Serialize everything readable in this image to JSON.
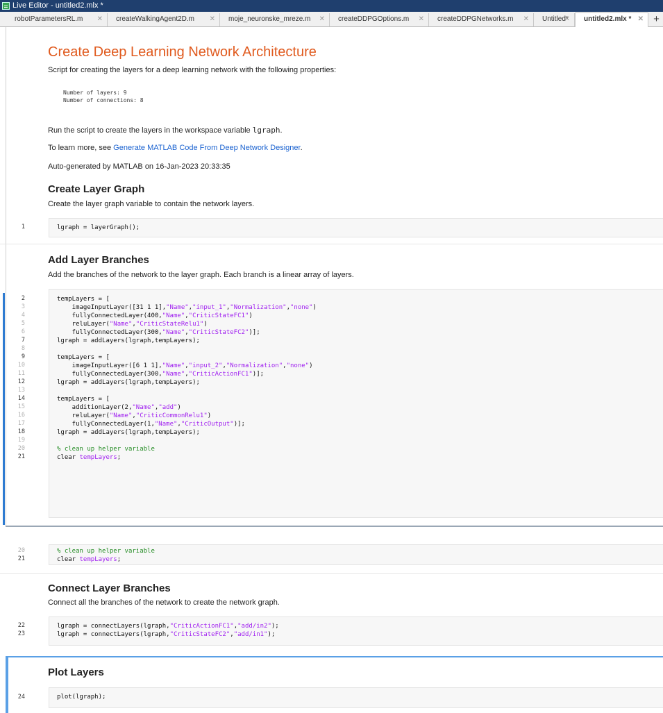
{
  "window": {
    "title": "Live Editor - untitled2.mlx *"
  },
  "tabs": [
    {
      "label": "robotParametersRL.m",
      "close": "✕"
    },
    {
      "label": "createWalkingAgent2D.m",
      "close": "✕"
    },
    {
      "label": "moje_neuronske_mreze.m",
      "close": "✕"
    },
    {
      "label": "createDDPGOptions.m",
      "close": "✕"
    },
    {
      "label": "createDDPGNetworks.m",
      "close": "✕"
    },
    {
      "label": "Untitled*",
      "close": "✕"
    },
    {
      "label": "untitled2.mlx *",
      "close": "✕"
    }
  ],
  "new_tab_label": "+",
  "doc": {
    "title": "Create Deep Learning Network Architecture",
    "intro": "Script for creating the layers for a deep learning network with the following properties:",
    "prop1": "Number of layers: 9",
    "prop2": "Number of connections: 8",
    "run_text_a": "Run the script to create the layers in the workspace variable ",
    "run_text_var": "lgraph",
    "run_text_b": ".",
    "learn_text": "To learn more, see ",
    "learn_link": "Generate MATLAB Code From Deep Network Designer",
    "learn_end": ".",
    "autogen": "Auto-generated by MATLAB on 16-Jan-2023 20:33:35",
    "s1_title": "Create Layer Graph",
    "s1_desc": "Create the layer graph variable to contain the network layers.",
    "s2_title": "Add Layer Branches",
    "s2_desc": "Add the branches of the network to the layer graph. Each branch is a linear array of layers.",
    "s3_title": "Connect Layer Branches",
    "s3_desc": "Connect all the branches of the network to create the network graph.",
    "s4_title": "Plot Layers"
  },
  "code": {
    "l1": "lgraph = layerGraph();",
    "l2": "tempLayers = [",
    "l3a": "    imageInputLayer([31 1 1],",
    "l3s1": "\"Name\"",
    "l3c1": ",",
    "l3s2": "\"input_1\"",
    "l3c2": ",",
    "l3s3": "\"Normalization\"",
    "l3c3": ",",
    "l3s4": "\"none\"",
    "l3e": ")",
    "l4a": "    fullyConnectedLayer(400,",
    "l4s1": "\"Name\"",
    "l4c1": ",",
    "l4s2": "\"CriticStateFC1\"",
    "l4e": ")",
    "l5a": "    reluLayer(",
    "l5s1": "\"Name\"",
    "l5c1": ",",
    "l5s2": "\"CriticStateRelu1\"",
    "l5e": ")",
    "l6a": "    fullyConnectedLayer(300,",
    "l6s1": "\"Name\"",
    "l6c1": ",",
    "l6s2": "\"CriticStateFC2\"",
    "l6e": ")];",
    "l7": "lgraph = addLayers(lgraph,tempLayers);",
    "l9": "tempLayers = [",
    "l10a": "    imageInputLayer([6 1 1],",
    "l10s1": "\"Name\"",
    "l10c1": ",",
    "l10s2": "\"input_2\"",
    "l10c2": ",",
    "l10s3": "\"Normalization\"",
    "l10c3": ",",
    "l10s4": "\"none\"",
    "l10e": ")",
    "l11a": "    fullyConnectedLayer(300,",
    "l11s1": "\"Name\"",
    "l11c1": ",",
    "l11s2": "\"CriticActionFC1\"",
    "l11e": ")];",
    "l12": "lgraph = addLayers(lgraph,tempLayers);",
    "l14": "tempLayers = [",
    "l15a": "    additionLayer(2,",
    "l15s1": "\"Name\"",
    "l15c1": ",",
    "l15s2": "\"add\"",
    "l15e": ")",
    "l16a": "    reluLayer(",
    "l16s1": "\"Name\"",
    "l16c1": ",",
    "l16s2": "\"CriticCommonRelu1\"",
    "l16e": ")",
    "l17a": "    fullyConnectedLayer(1,",
    "l17s1": "\"Name\"",
    "l17c1": ",",
    "l17s2": "\"CriticOutput\"",
    "l17e": ")];",
    "l18": "lgraph = addLayers(lgraph,tempLayers);",
    "l20": "% clean up helper variable",
    "l21a": "clear ",
    "l21b": "tempLayers",
    "l21c": ";",
    "l22a": "lgraph = connectLayers(lgraph,",
    "l22s1": "\"CriticActionFC1\"",
    "l22c1": ",",
    "l22s2": "\"add/in2\"",
    "l22e": ");",
    "l23a": "lgraph = connectLayers(lgraph,",
    "l23s1": "\"CriticStateFC2\"",
    "l23c1": ",",
    "l23s2": "\"add/in1\"",
    "l23e": ");",
    "l24": "plot(lgraph);"
  },
  "line_numbers": {
    "n1": "1",
    "n2": "2",
    "n3": "3",
    "n4": "4",
    "n5": "5",
    "n6": "6",
    "n7": "7",
    "n8": "8",
    "n9": "9",
    "n10": "10",
    "n11": "11",
    "n12": "12",
    "n13": "13",
    "n14": "14",
    "n15": "15",
    "n16": "16",
    "n17": "17",
    "n18": "18",
    "n19": "19",
    "n20": "20",
    "n21": "21",
    "n20b": "20",
    "n21b": "21",
    "n22": "22",
    "n23": "23",
    "n24": "24"
  },
  "colors": {
    "title": "#e05a1e",
    "link": "#1a62d0",
    "string": "#a020f0",
    "comment": "#228b22",
    "titlebar": "#1f3f6e"
  }
}
